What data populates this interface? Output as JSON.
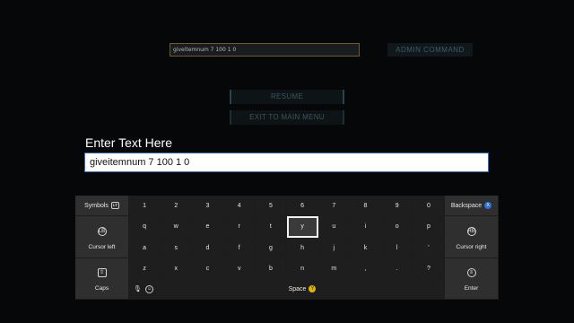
{
  "background": {
    "admin_input_value": "giveitemnum 7 100 1 0",
    "admin_button_label": "ADMIN COMMAND",
    "resume_label": "RESUME",
    "exit_label": "EXIT TO MAIN MENU"
  },
  "prompt": {
    "label": "Enter Text Here",
    "value": "giveitemnum 7 100 1 0"
  },
  "keyboard": {
    "symbols_label": "Symbols",
    "symbols_badge": "LT",
    "backspace_label": "Backspace",
    "backspace_badge": "X",
    "cursor_left_label": "Cursor left",
    "cursor_right_label": "Cursor right",
    "caps_label": "Caps",
    "space_label": "Space",
    "space_badge": "Y",
    "enter_label": "Enter",
    "row1": [
      "1",
      "2",
      "3",
      "4",
      "5",
      "6",
      "7",
      "8",
      "9",
      "0"
    ],
    "row2": [
      "q",
      "w",
      "e",
      "r",
      "t",
      "y",
      "u",
      "i",
      "o",
      "p"
    ],
    "row3": [
      "a",
      "s",
      "d",
      "f",
      "g",
      "h",
      "j",
      "k",
      "l",
      "'"
    ],
    "row4": [
      "z",
      "x",
      "c",
      "v",
      "b",
      "n",
      "m",
      ",",
      ".",
      "?"
    ],
    "selected_key": "y",
    "accent_x": "#2f6fd8",
    "accent_y": "#e0b400"
  }
}
